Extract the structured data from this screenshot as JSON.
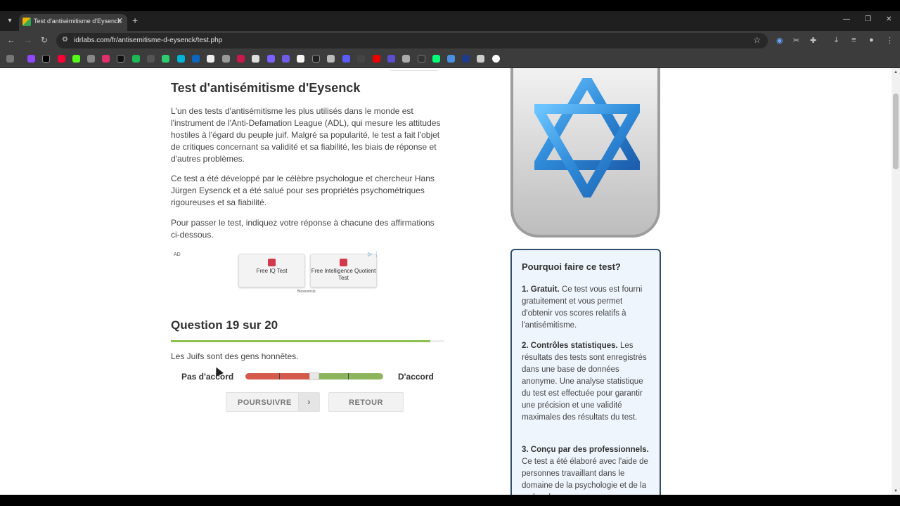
{
  "browser": {
    "tab_title": "Test d'antisémitisme d'Eysenck",
    "url": "idrlabs.com/fr/antisemitisme-d-eysenck/test.php"
  },
  "article": {
    "title": "Test d'antisémitisme d'Eysenck",
    "paragraphs": [
      "L'un des tests d'antisémitisme les plus utilisés dans le monde est l'instrument de l'Anti-Defamation League (ADL), qui mesure les attitudes hostiles à l'égard du peuple juif. Malgré sa popularité, le test a fait l'objet de critiques concernant sa validité et sa fiabilité, les biais de réponse et d'autres problèmes.",
      "Ce test a été développé par le célèbre psychologue et chercheur Hans Jürgen Eysenck et a été salué pour ses propriétés psychométriques rigoureuses et sa fiabilité.",
      "Pour passer le test, indiquez votre réponse à chacune des affirmations ci-dessous."
    ]
  },
  "ad": {
    "label": "AD",
    "card1": "Free IQ Test",
    "card2": "Free Intelligence Quotient Test",
    "brand": "BlossomUp"
  },
  "question": {
    "title": "Question 19 sur 20",
    "progress": 0.95,
    "statement": "Les Juifs sont des gens honnêtes.",
    "scale_left": "Pas d'accord",
    "scale_right": "D'accord",
    "slider_value": 0.5
  },
  "buttons": {
    "next": "POURSUIVRE",
    "back": "RETOUR"
  },
  "why": {
    "title": "Pourquoi faire ce test?",
    "items": [
      {
        "head": "1. Gratuit.",
        "text": " Ce test vous est fourni gratuitement et vous permet d'obtenir vos scores relatifs à l'antisémitisme."
      },
      {
        "head": "2. Contrôles statistiques.",
        "text": " Les résultats des tests sont enregistrés dans une base de données anonyme. Une analyse statistique du test est effectuée pour garantir une précision et une validité maximales des résultats du test."
      },
      {
        "head": "3. Conçu par des professionnels.",
        "text": " Ce test a été élaboré avec l'aide de personnes travaillant dans le domaine de la psychologie et de la recherche sur"
      }
    ]
  },
  "colors": {
    "progress": "#8cc152",
    "disagree": "#d45a4c",
    "agree": "#8eb55e",
    "star": "#2e8ad8"
  }
}
